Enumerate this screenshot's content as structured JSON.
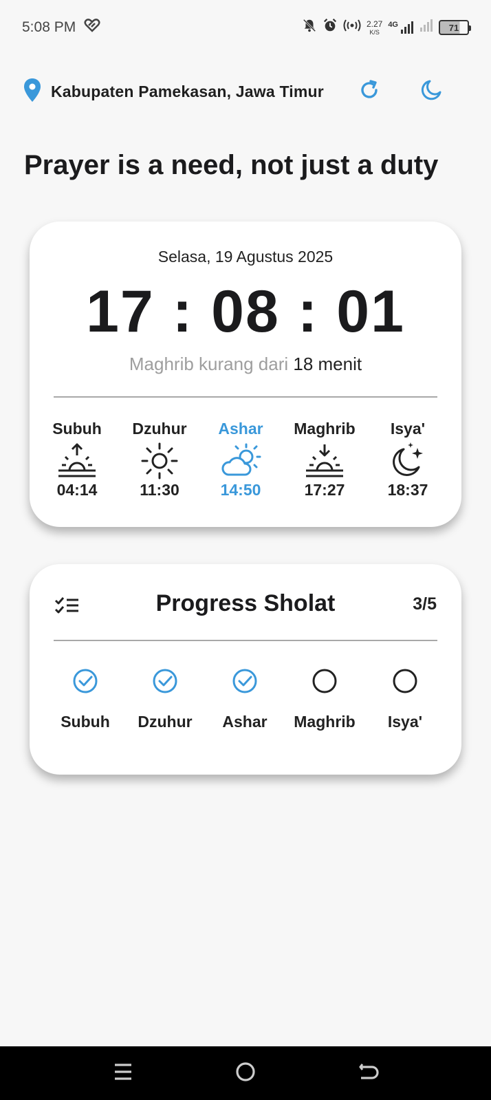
{
  "status_bar": {
    "time": "5:08 PM",
    "net_speed_value": "2.27",
    "net_speed_unit": "K/S",
    "network": "4G",
    "battery": "71"
  },
  "location": {
    "label": "Kabupaten Pamekasan, Jawa Timur"
  },
  "tagline": "Prayer is a need, not just a duty",
  "time_card": {
    "date": "Selasa, 19 Agustus 2025",
    "clock": "17 : 08 : 01",
    "countdown_prefix": "Maghrib kurang dari ",
    "countdown_value": "18 menit"
  },
  "prayer_times": [
    {
      "name": "Subuh",
      "time": "04:14",
      "icon": "sunrise-icon",
      "active": false
    },
    {
      "name": "Dzuhur",
      "time": "11:30",
      "icon": "sun-icon",
      "active": false
    },
    {
      "name": "Ashar",
      "time": "14:50",
      "icon": "cloud-sun-icon",
      "active": true
    },
    {
      "name": "Maghrib",
      "time": "17:27",
      "icon": "sunset-icon",
      "active": false
    },
    {
      "name": "Isya'",
      "time": "18:37",
      "icon": "moon-stars-icon",
      "active": false
    }
  ],
  "progress": {
    "title": "Progress Sholat",
    "count": "3/5",
    "items": [
      {
        "name": "Subuh",
        "done": true
      },
      {
        "name": "Dzuhur",
        "done": true
      },
      {
        "name": "Ashar",
        "done": true
      },
      {
        "name": "Maghrib",
        "done": false
      },
      {
        "name": "Isya'",
        "done": false
      }
    ]
  },
  "colors": {
    "accent": "#3a98da",
    "text": "#1b1b1d",
    "muted": "#9e9e9e",
    "background": "#f7f7f7"
  }
}
